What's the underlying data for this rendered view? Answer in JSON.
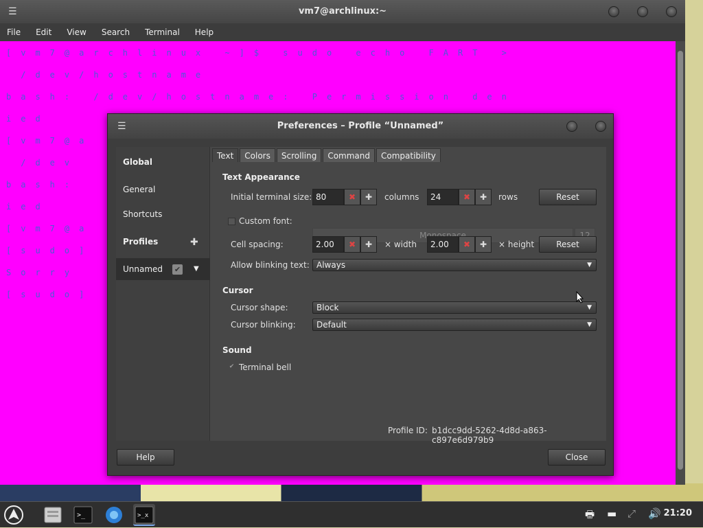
{
  "terminal": {
    "title": "vm7@archlinux:~",
    "menu": [
      "File",
      "Edit",
      "View",
      "Search",
      "Terminal",
      "Help"
    ],
    "lines": [
      "[vm7@archlinux ~]$ sudo echo FART >",
      " /dev/hostname",
      "bash: /dev/hostname: Permission den",
      "ied",
      "[vm7@a",
      " /dev",
      "bash:",
      "ied",
      "[vm7@a",
      "[sudo]",
      "Sorry",
      "[sudo]"
    ],
    "colors": {
      "background": "#ff00ff",
      "text": "#4c5bd4"
    }
  },
  "dialog": {
    "title": "Preferences – Profile “Unnamed”",
    "sidebar": {
      "global_label": "Global",
      "general_label": "General",
      "shortcuts_label": "Shortcuts",
      "profiles_label": "Profiles",
      "profile_name": "Unnamed"
    },
    "tabs": [
      "Text",
      "Colors",
      "Scrolling",
      "Command",
      "Compatibility"
    ],
    "text_tab": {
      "text_appearance_heading": "Text Appearance",
      "initial_size_label": "Initial terminal size:",
      "columns_value": "80",
      "columns_label": "columns",
      "rows_value": "24",
      "rows_label": "rows",
      "reset_label": "Reset",
      "custom_font_label": "Custom font:",
      "font_name": "Monospace",
      "font_size": "12",
      "cell_spacing_label": "Cell spacing:",
      "width_value": "2.00",
      "width_label": "× width",
      "height_value": "2.00",
      "height_label": "× height",
      "reset2_label": "Reset",
      "blinking_text_label": "Allow blinking text:",
      "blinking_text_value": "Always",
      "cursor_heading": "Cursor",
      "cursor_shape_label": "Cursor shape:",
      "cursor_shape_value": "Block",
      "cursor_blinking_label": "Cursor blinking:",
      "cursor_blinking_value": "Default",
      "sound_heading": "Sound",
      "terminal_bell_label": "Terminal bell",
      "profile_id_label": "Profile ID:",
      "profile_id_value": "b1dcc9dd-5262-4d8d-a863-c897e6d979b9"
    },
    "help_label": "Help",
    "close_label": "Close"
  },
  "taskbar": {
    "clock": "21:20",
    "icons": [
      "arch-logo-icon",
      "file-manager-icon",
      "terminal-icon",
      "browser-icon",
      "terminal-active-icon"
    ],
    "tray": [
      "printer-icon",
      "keyboard-icon",
      "network-icon",
      "volume-icon"
    ]
  }
}
